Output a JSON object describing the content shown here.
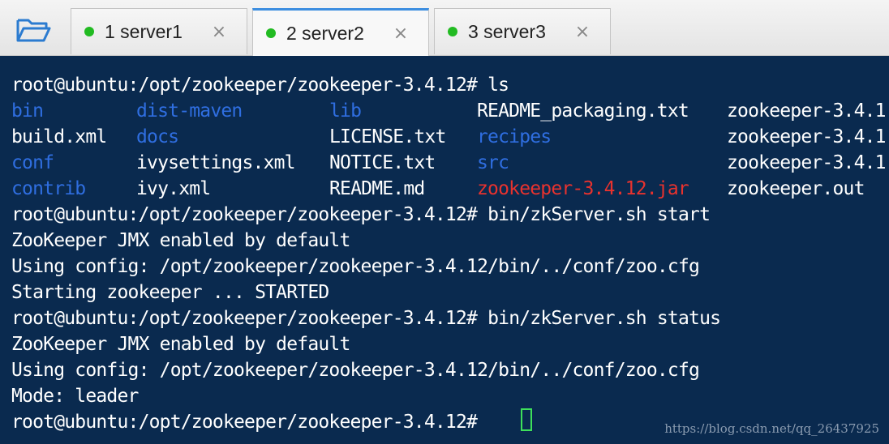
{
  "colors": {
    "terminal_bg": "#0a2a4f",
    "text": "#ffffff",
    "dir": "#2f6ee0",
    "archive": "#e8322e",
    "status_dot": "#22bb22",
    "cursor": "#3ee05a",
    "accent": "#3d8ee0"
  },
  "toolbar": {
    "folder_icon": "folder-icon"
  },
  "tabs": [
    {
      "label": "1 server1",
      "close": "×",
      "active": false
    },
    {
      "label": "2 server2",
      "close": "×",
      "active": true
    },
    {
      "label": "3 server3",
      "close": "×",
      "active": false
    }
  ],
  "terminal": {
    "prompt1": "root@ubuntu:/opt/zookeeper/zookeeper-3.4.12# ls",
    "ls": {
      "col1": [
        "bin",
        "build.xml",
        "conf",
        "contrib"
      ],
      "col2": [
        "dist-maven",
        "docs",
        "ivysettings.xml",
        "ivy.xml"
      ],
      "col3": [
        "lib",
        "LICENSE.txt",
        "NOTICE.txt",
        "README.md"
      ],
      "col4": [
        "README_packaging.txt",
        "recipes",
        "src",
        "zookeeper-3.4.12.jar"
      ],
      "col5": [
        "zookeeper-3.4.1",
        "zookeeper-3.4.1",
        "zookeeper-3.4.1",
        "zookeeper.out"
      ]
    },
    "prompt2": "root@ubuntu:/opt/zookeeper/zookeeper-3.4.12# bin/zkServer.sh start",
    "out1": "ZooKeeper JMX enabled by default",
    "out2": "Using config: /opt/zookeeper/zookeeper-3.4.12/bin/../conf/zoo.cfg",
    "out3": "Starting zookeeper ... STARTED",
    "prompt3": "root@ubuntu:/opt/zookeeper/zookeeper-3.4.12# bin/zkServer.sh status",
    "out4": "ZooKeeper JMX enabled by default",
    "out5": "Using config: /opt/zookeeper/zookeeper-3.4.12/bin/../conf/zoo.cfg",
    "out6": "Mode: leader",
    "prompt4": "root@ubuntu:/opt/zookeeper/zookeeper-3.4.12# "
  },
  "watermark": "https://blog.csdn.net/qq_26437925"
}
